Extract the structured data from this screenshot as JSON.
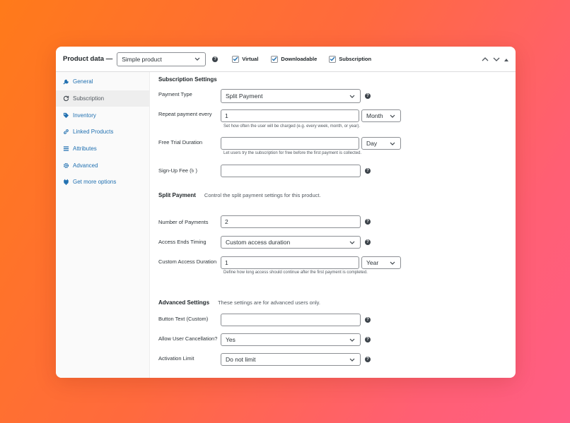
{
  "header": {
    "title": "Product data —",
    "product_type": "Simple product",
    "checkboxes": [
      {
        "label": "Virtual",
        "checked": true
      },
      {
        "label": "Downloadable",
        "checked": true
      },
      {
        "label": "Subscription",
        "checked": true
      }
    ]
  },
  "sidebar": {
    "items": [
      {
        "label": "General",
        "icon": "wrench-icon",
        "active": false
      },
      {
        "label": "Subscription",
        "icon": "refresh-icon",
        "active": true
      },
      {
        "label": "Inventory",
        "icon": "tag-icon",
        "active": false
      },
      {
        "label": "Linked Products",
        "icon": "link-icon",
        "active": false
      },
      {
        "label": "Attributes",
        "icon": "list-icon",
        "active": false
      },
      {
        "label": "Advanced",
        "icon": "gear-icon",
        "active": false
      },
      {
        "label": "Get more options",
        "icon": "plugin-icon",
        "active": false
      }
    ]
  },
  "subscription": {
    "title": "Subscription Settings",
    "payment_type_label": "Payment Type",
    "payment_type_value": "Split Payment",
    "repeat_label": "Repeat payment every",
    "repeat_value": "1",
    "repeat_unit": "Month",
    "repeat_desc": "Set how often the user will be charged (e.g. every week, month, or year).",
    "trial_label": "Free Trial Duration",
    "trial_value": "",
    "trial_unit": "Day",
    "trial_desc": "Let users try the subscription for free before the first payment is collected.",
    "signup_label": "Sign-Up Fee (৳ )",
    "signup_value": ""
  },
  "split": {
    "title": "Split Payment",
    "desc": "Control the split payment settings for this product.",
    "num_label": "Number of Payments",
    "num_value": "2",
    "ends_label": "Access Ends Timing",
    "ends_value": "Custom access duration",
    "custom_label": "Custom Access Duration",
    "custom_value": "1",
    "custom_unit": "Year",
    "custom_desc": "Define how long access should continue after the first payment is completed."
  },
  "advanced": {
    "title": "Advanced Settings",
    "desc": "These settings are for advanced users only.",
    "button_label": "Button Text (Custom)",
    "button_value": "",
    "cancel_label": "Allow User Cancellation?",
    "cancel_value": "Yes",
    "limit_label": "Activation Limit",
    "limit_value": "Do not limit"
  }
}
